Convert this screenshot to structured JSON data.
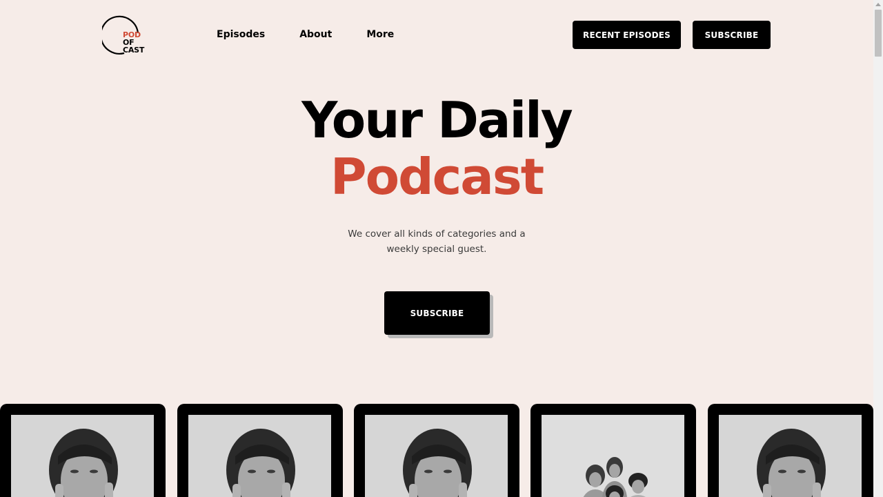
{
  "logo": {
    "line1": "POD",
    "line2": "OF",
    "line3": "CAST",
    "accent": "#d04a35"
  },
  "nav": {
    "items": [
      "Episodes",
      "About",
      "More"
    ]
  },
  "header_buttons": {
    "recent": "RECENT EPISODES",
    "subscribe": "SUBSCRIBE"
  },
  "hero": {
    "line1": "Your Daily",
    "line2": "Podcast",
    "subtitle": "We cover all kinds of categories and a weekly special guest.",
    "cta": "SUBSCRIBE"
  },
  "cards": [
    {
      "photo": "woman-portrait"
    },
    {
      "photo": "woman-portrait"
    },
    {
      "photo": "woman-portrait"
    },
    {
      "photo": "group-portrait"
    },
    {
      "photo": "woman-portrait"
    }
  ],
  "colors": {
    "background": "#f6ece8",
    "accent": "#d04a35",
    "dark": "#000000"
  }
}
